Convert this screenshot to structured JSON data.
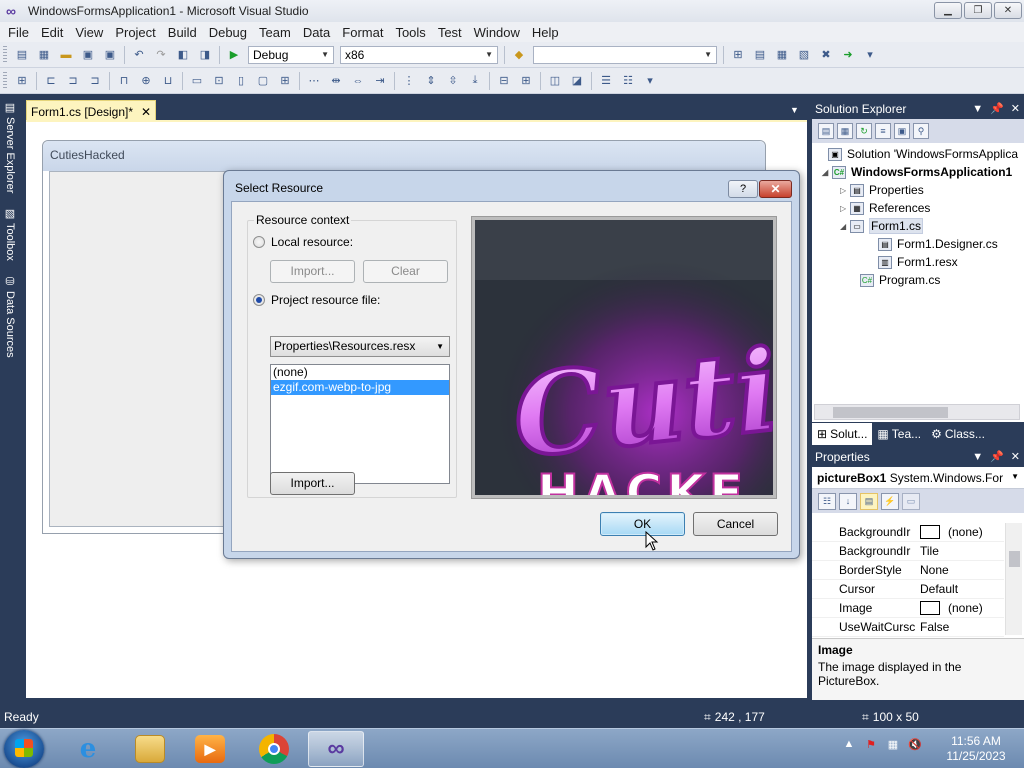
{
  "window": {
    "title": "WindowsFormsApplication1 - Microsoft Visual Studio"
  },
  "menu": [
    "File",
    "Edit",
    "View",
    "Project",
    "Build",
    "Debug",
    "Team",
    "Data",
    "Format",
    "Tools",
    "Test",
    "Window",
    "Help"
  ],
  "toolbar": {
    "config": "Debug",
    "platform": "x86",
    "search_value": ""
  },
  "left_dock": {
    "server_explorer": "Server Explorer",
    "toolbox": "Toolbox",
    "data_sources": "Data Sources"
  },
  "document": {
    "tab_label": "Form1.cs [Design]*",
    "form_caption": "CutiesHacked"
  },
  "dialog": {
    "title": "Select Resource",
    "help": "?",
    "close": "✕",
    "context_legend": "Resource context",
    "local_resource": "Local resource:",
    "import_label": "Import...",
    "clear_label": "Clear",
    "project_resource_file": "Project resource file:",
    "resource_file_value": "Properties\\Resources.resx",
    "resources": [
      {
        "name": "(none)",
        "selected": false
      },
      {
        "name": "ezgif.com-webp-to-jpg",
        "selected": true
      }
    ],
    "import_button": "Import...",
    "ok": "OK",
    "cancel": "Cancel",
    "preview_text_1": "Cutie",
    "preview_text_2": "HACKE"
  },
  "solution_explorer": {
    "title": "Solution Explorer",
    "items": [
      {
        "label": "Solution 'WindowsFormsApplica",
        "bold": false
      },
      {
        "label": "WindowsFormsApplication1",
        "bold": true
      },
      {
        "label": "Properties",
        "bold": false
      },
      {
        "label": "References",
        "bold": false
      },
      {
        "label": "Form1.cs",
        "bold": false
      },
      {
        "label": "Form1.Designer.cs",
        "bold": false
      },
      {
        "label": "Form1.resx",
        "bold": false
      },
      {
        "label": "Program.cs",
        "bold": false
      }
    ],
    "tabs": [
      "Solut...",
      "Tea...",
      "Class..."
    ]
  },
  "properties": {
    "title": "Properties",
    "object_name": "pictureBox1",
    "object_type": "System.Windows.For",
    "rows": [
      {
        "name": "BackgroundIr",
        "value": "(none)",
        "swatch": true
      },
      {
        "name": "BackgroundIr",
        "value": "Tile",
        "swatch": false
      },
      {
        "name": "BorderStyle",
        "value": "None",
        "swatch": false
      },
      {
        "name": "Cursor",
        "value": "Default",
        "swatch": false
      },
      {
        "name": "Image",
        "value": "(none)",
        "swatch": true
      },
      {
        "name": "UseWaitCursc",
        "value": "False",
        "swatch": false
      }
    ],
    "description_name": "Image",
    "description_text": "The image displayed in the PictureBox."
  },
  "status": {
    "text": "Ready",
    "position": "242 , 177",
    "size": "100 x 50"
  },
  "taskbar": {
    "time": "11:56 AM",
    "date": "11/25/2023"
  },
  "colors": {
    "vs_dark": "#2b3c59",
    "tab_yellow": "#fdf4bf",
    "selection_blue": "#3399ff",
    "preview_pink": "#d35ee8"
  }
}
